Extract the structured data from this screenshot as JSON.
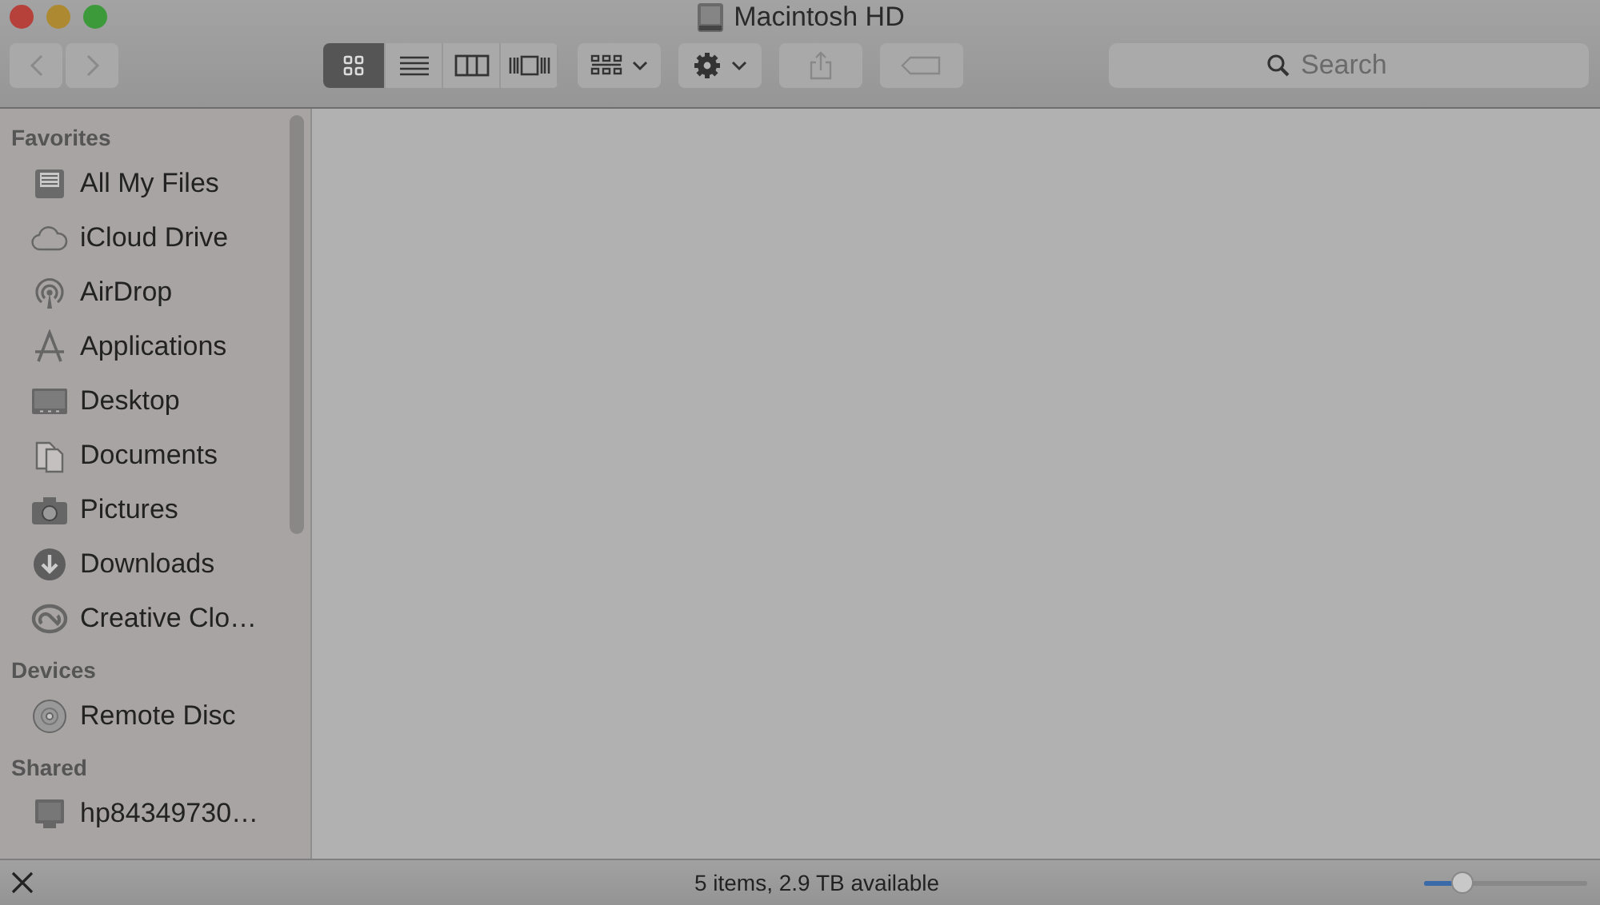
{
  "window": {
    "title": "Macintosh HD"
  },
  "view_modes": [
    {
      "kind": "icons",
      "selected": true
    },
    {
      "kind": "list",
      "selected": false
    },
    {
      "kind": "columns",
      "selected": false
    },
    {
      "kind": "coverflow",
      "selected": false
    }
  ],
  "search": {
    "placeholder": "Search"
  },
  "sidebar": {
    "sections": [
      {
        "heading": "Favorites",
        "items": [
          {
            "label": "All My Files",
            "kind": "files"
          },
          {
            "label": "iCloud Drive",
            "kind": "cloud"
          },
          {
            "label": "AirDrop",
            "kind": "airdrop"
          },
          {
            "label": "Applications",
            "kind": "apps"
          },
          {
            "label": "Desktop",
            "kind": "desktop"
          },
          {
            "label": "Documents",
            "kind": "documents"
          },
          {
            "label": "Pictures",
            "kind": "camera"
          },
          {
            "label": "Downloads",
            "kind": "download"
          },
          {
            "label": "Creative Clo…",
            "kind": "creative"
          }
        ]
      },
      {
        "heading": "Devices",
        "items": [
          {
            "label": "Remote Disc",
            "kind": "disc"
          }
        ]
      },
      {
        "heading": "Shared",
        "items": [
          {
            "label": "hp84349730…",
            "kind": "computer"
          }
        ]
      }
    ]
  },
  "status_bar": {
    "text": "5 items, 2.9 TB available",
    "zoom": {
      "level": 0.24
    }
  }
}
